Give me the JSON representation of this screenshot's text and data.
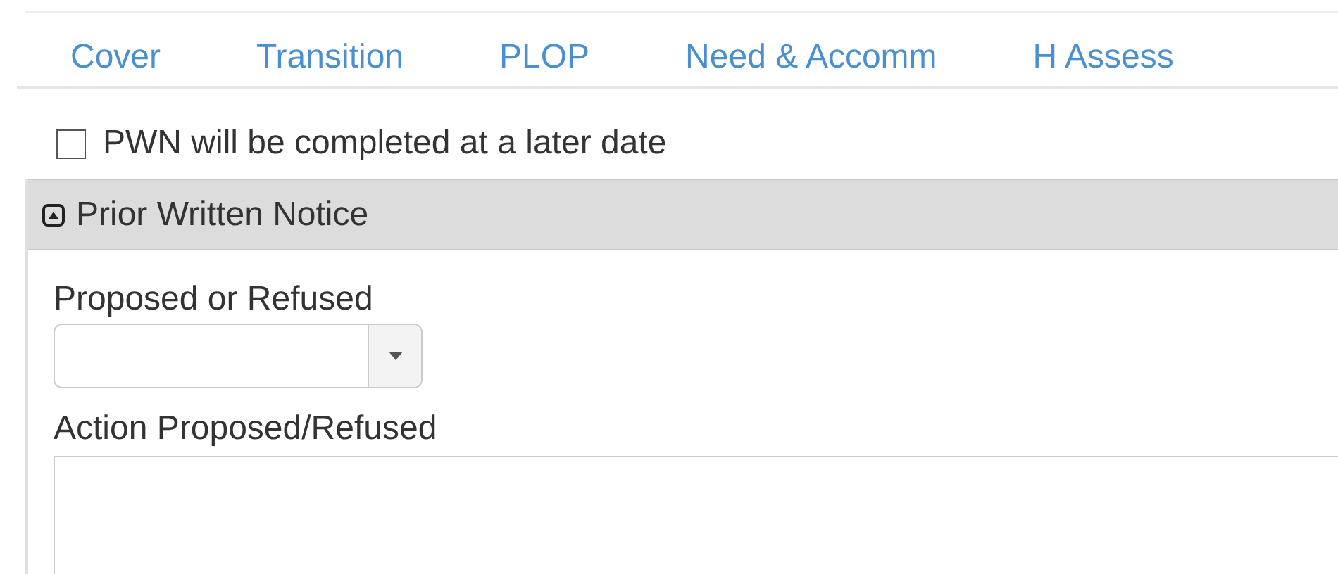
{
  "tabs": [
    {
      "label": "Cover",
      "selected": false
    },
    {
      "label": "Transition",
      "selected": false
    },
    {
      "label": "PLOP",
      "selected": false
    },
    {
      "label": "Need & Accomm",
      "selected": false
    },
    {
      "label": "H Assess",
      "selected": false
    }
  ],
  "pwn_later": {
    "label": "PWN will be completed at a later date",
    "checked": false
  },
  "panel": {
    "title": "Prior Written Notice",
    "expanded": true,
    "fields": [
      {
        "kind": "select",
        "label": "Proposed or Refused"
      },
      {
        "kind": "textarea",
        "label": "Action Proposed/Refused"
      }
    ]
  }
}
